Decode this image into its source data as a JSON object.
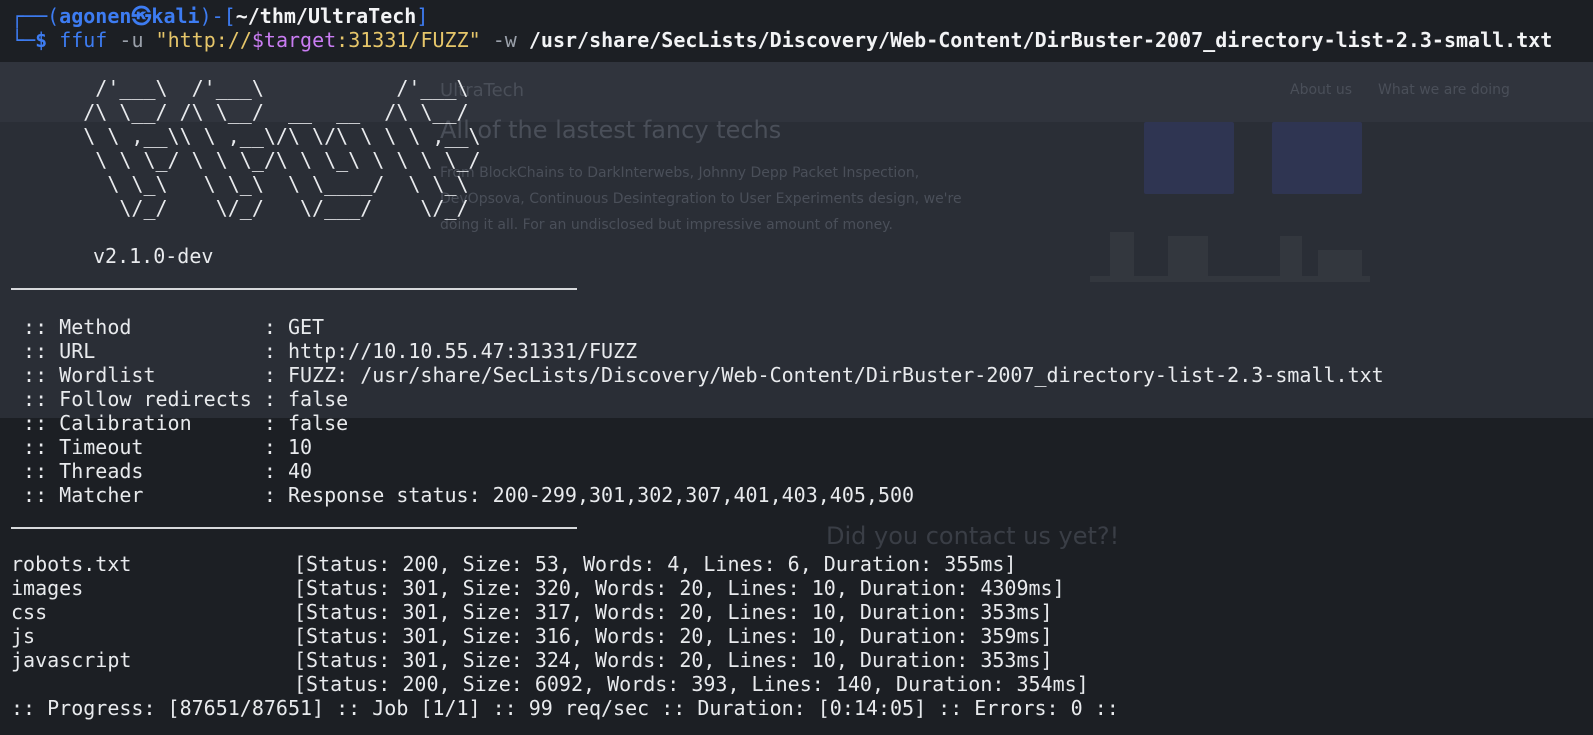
{
  "prompt": {
    "frame_open": "┌──(",
    "user": "agonen",
    "skull": "㉿",
    "host": "kali",
    "frame_mid": ")-[",
    "directory": "~/thm/UltraTech",
    "frame_close": "]",
    "frame_lower": "└─",
    "dollar": "$"
  },
  "command": {
    "program": "ffuf",
    "flag_u": "-u",
    "url_open": "\"http://",
    "url_var": "$target",
    "url_rest": ":31331/FUZZ\"",
    "flag_w": "-w",
    "wordlist": "/usr/share/SecLists/Discovery/Web-Content/DirBuster-2007_directory-list-2.3-small.txt"
  },
  "banner": {
    "art": [
      "       /'___\\  /'___\\           /'___\\",
      "      /\\ \\__/ /\\ \\__/  __  __  /\\ \\__/",
      "      \\ \\ ,__\\\\ \\ ,__\\/\\ \\/\\ \\ \\ \\ ,__\\",
      "       \\ \\ \\_/ \\ \\ \\_/\\ \\ \\_\\ \\ \\ \\ \\_/",
      "        \\ \\_\\   \\ \\_\\  \\ \\____/  \\ \\_\\",
      "         \\/_/    \\/_/   \\/___/    \\/_/"
    ],
    "version": "v2.1.0-dev"
  },
  "config": [
    {
      "key": " :: Method           ",
      "value": ": GET"
    },
    {
      "key": " :: URL              ",
      "value": ": http://10.10.55.47:31331/FUZZ"
    },
    {
      "key": " :: Wordlist         ",
      "value": ": FUZZ: /usr/share/SecLists/Discovery/Web-Content/DirBuster-2007_directory-list-2.3-small.txt"
    },
    {
      "key": " :: Follow redirects ",
      "value": ": false"
    },
    {
      "key": " :: Calibration      ",
      "value": ": false"
    },
    {
      "key": " :: Timeout          ",
      "value": ": 10"
    },
    {
      "key": " :: Threads          ",
      "value": ": 40"
    },
    {
      "key": " :: Matcher          ",
      "value": ": Response status: 200-299,301,302,307,401,403,405,500"
    }
  ],
  "results": [
    {
      "name": "robots.txt",
      "info": "[Status: 200, Size: 53, Words: 4, Lines: 6, Duration: 355ms]"
    },
    {
      "name": "images",
      "info": "[Status: 301, Size: 320, Words: 20, Lines: 10, Duration: 4309ms]"
    },
    {
      "name": "css",
      "info": "[Status: 301, Size: 317, Words: 20, Lines: 10, Duration: 353ms]"
    },
    {
      "name": "js",
      "info": "[Status: 301, Size: 316, Words: 20, Lines: 10, Duration: 359ms]"
    },
    {
      "name": "javascript",
      "info": "[Status: 301, Size: 324, Words: 20, Lines: 10, Duration: 353ms]"
    },
    {
      "name": "",
      "info": "[Status: 200, Size: 6092, Words: 393, Lines: 140, Duration: 354ms]"
    }
  ],
  "progress": ":: Progress: [87651/87651] :: Job [1/1] :: 99 req/sec :: Duration: [0:14:05] :: Errors: 0 ::",
  "background_page": {
    "brand": "UltraTech",
    "nav_about": "About us",
    "nav_what": "What we are doing",
    "headline": "All of the lastest fancy techs",
    "para1": "From BlockChains to DarkInterwebs, Johnny Depp Packet Inspection,",
    "para2": "DevOpsova, Continuous Desintegration to User Experiments design, we're",
    "para3": "doing it all. For an undisclosed but impressive amount of money.",
    "contact": "Did you contact us yet?!"
  },
  "colors": {
    "background": "#1c1f24",
    "prompt_blue": "#3d7cf2",
    "string_yellow": "#e6c66a",
    "variable_purple": "#c97cf2",
    "text": "#e8eaed"
  }
}
